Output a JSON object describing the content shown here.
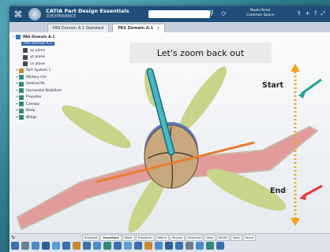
{
  "app": {
    "title": "CATIA Part Design Essentials",
    "subtitle": "3DEXPERIENCE",
    "search_placeholder": "Search",
    "user_name": "Noah Perez",
    "user_role": "Common Space"
  },
  "tabs": [
    {
      "label": "PAS Domain A.1 Standard"
    },
    {
      "label": "PAS Domain A.1"
    }
  ],
  "tree": {
    "root": "PAS Domain A.1",
    "selected": "PAS Domain A.1",
    "items": [
      {
        "label": "xy plane"
      },
      {
        "label": "yz plane"
      },
      {
        "label": "zx plane"
      },
      {
        "label": "Part System 1"
      },
      {
        "label": "Military Ctrl"
      },
      {
        "label": "Vertical fin"
      },
      {
        "label": "Horizontal Stabilizer"
      },
      {
        "label": "Propeller"
      },
      {
        "label": "Canopy"
      },
      {
        "label": "Body"
      },
      {
        "label": "Wings"
      }
    ]
  },
  "overlay": {
    "text": "Let's zoom back out"
  },
  "annotations": {
    "start": "Start",
    "end": "End"
  },
  "toolbar": {
    "tabs": [
      "Standard",
      "Essentials",
      "Mode",
      "Transform",
      "Refine",
      "Review",
      "Structure",
      "View",
      "AR-VR",
      "Tools",
      "Touch"
    ],
    "active_tab": "Essentials"
  },
  "colors": {
    "title_bar": "#1e4e79",
    "viewport_bg": "#f3f5f7",
    "wing": "#e29a9a",
    "blade": "#c8d489",
    "body": "#c7a77b",
    "antenna": "#46b7c7",
    "axis": "#e87d2f",
    "arrow_dots": "#f0a31a",
    "start_arrow": "#21a58f",
    "end_arrow": "#e23a3a"
  }
}
